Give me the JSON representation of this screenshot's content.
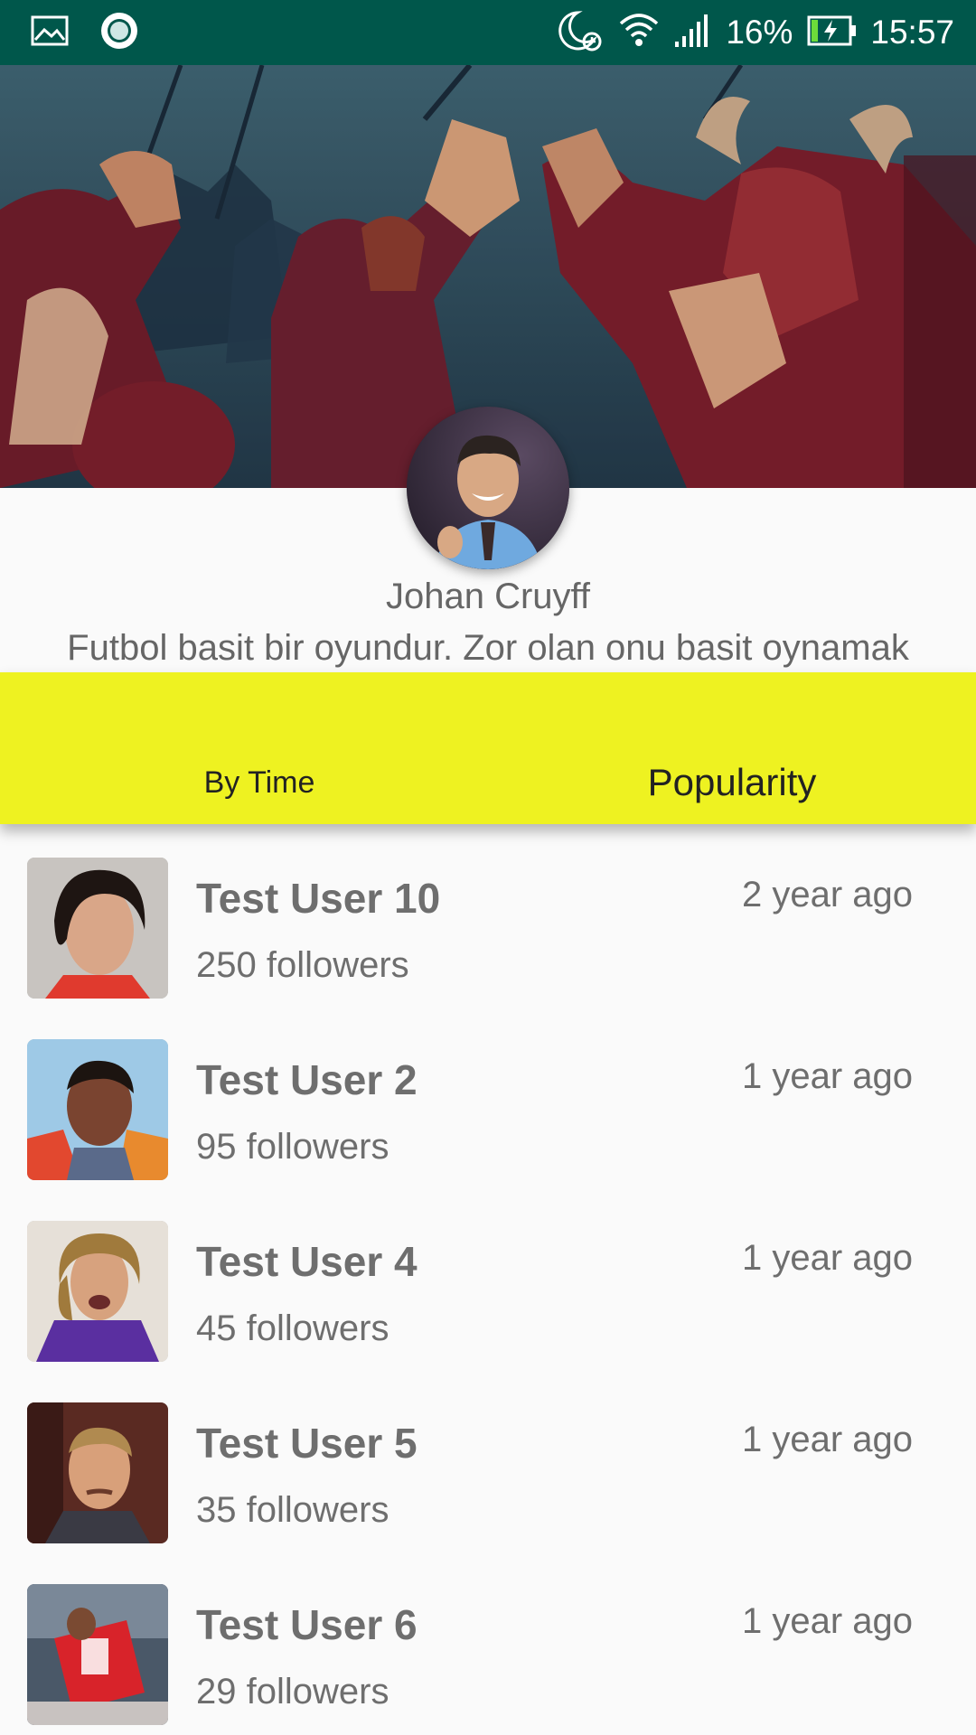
{
  "status_bar": {
    "left_icons": [
      "image-icon",
      "record-icon"
    ],
    "right_icons": [
      "moon-alarm-icon",
      "wifi-icon",
      "signal-icon",
      "battery-charging-icon"
    ],
    "battery": "16%",
    "time": "15:57",
    "background_color": "#00574b"
  },
  "profile": {
    "name": "Johan Cruyff",
    "bio": "Futbol basit bir oyundur. Zor olan onu basit oynamak"
  },
  "tabs": [
    {
      "label": "By Time",
      "selected": false
    },
    {
      "label": "Popularity",
      "selected": true
    }
  ],
  "tab_bar_color": "#eef221",
  "users": [
    {
      "name": "Test User 10",
      "followers": "250 followers",
      "time": "2 year ago"
    },
    {
      "name": "Test User 2",
      "followers": "95 followers",
      "time": "1 year ago"
    },
    {
      "name": "Test User 4",
      "followers": "45 followers",
      "time": "1 year ago"
    },
    {
      "name": "Test User 5",
      "followers": "35 followers",
      "time": "1 year ago"
    },
    {
      "name": "Test User 6",
      "followers": "29 followers",
      "time": "1 year ago"
    }
  ]
}
